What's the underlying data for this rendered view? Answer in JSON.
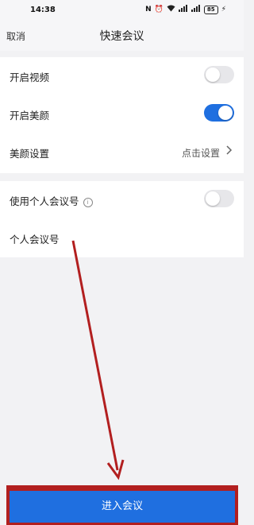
{
  "status_bar": {
    "time": "14:38",
    "battery": "85"
  },
  "nav": {
    "cancel_label": "取消",
    "title": "快速会议"
  },
  "settings": {
    "video": {
      "label": "开启视频",
      "enabled": false
    },
    "beauty": {
      "label": "开启美颜",
      "enabled": true
    },
    "beauty_settings": {
      "label": "美颜设置",
      "value": "点击设置"
    },
    "personal_id": {
      "label": "使用个人会议号",
      "enabled": false
    },
    "personal_id_number": {
      "label": "个人会议号"
    }
  },
  "action": {
    "join_label": "进入会议"
  },
  "colors": {
    "accent": "#1f6fe0",
    "annotation": "#b21f1f"
  }
}
